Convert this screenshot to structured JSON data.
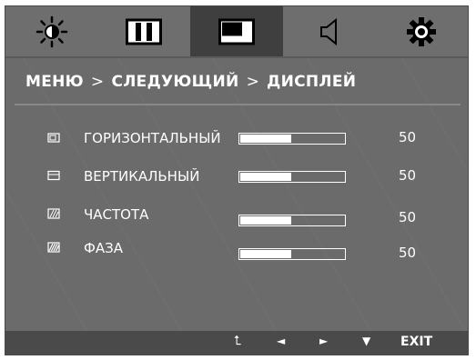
{
  "tabs": [
    {
      "icon": "brightness-icon",
      "active": false
    },
    {
      "icon": "picture-icon",
      "active": false
    },
    {
      "icon": "display-icon",
      "active": true
    },
    {
      "icon": "audio-icon",
      "active": false
    },
    {
      "icon": "settings-icon",
      "active": false
    }
  ],
  "breadcrumb": {
    "menu": "МЕНЮ",
    "sep1": ">",
    "next": "СЛЕДУЮЩИЙ",
    "sep2": ">",
    "current": "ДИСПЛЕЙ"
  },
  "settings": [
    {
      "label": "ГОРИЗОНТАЛЬНЫЙ",
      "value": "50",
      "level": 0.5,
      "icon": "horizontal-position-icon"
    },
    {
      "label": "ВЕРТИКАЛЬНЫЙ",
      "value": "50",
      "level": 0.5,
      "icon": "vertical-position-icon"
    },
    {
      "label": "ЧАСТОТА",
      "value": "50",
      "level": 0.5,
      "icon": "clock-icon"
    },
    {
      "label": "ФАЗА",
      "value": "50",
      "level": 0.5,
      "icon": "phase-icon"
    }
  ],
  "bottom_nav": {
    "back": "⮤",
    "left": "◄",
    "right": "►",
    "down": "▼",
    "exit": "EXIT"
  }
}
